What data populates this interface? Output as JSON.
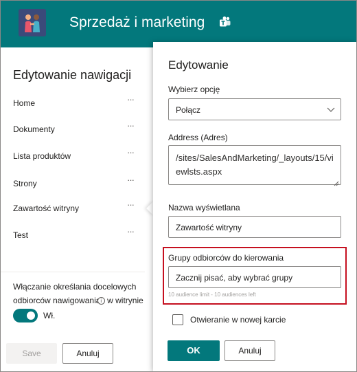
{
  "header": {
    "site_title": "Sprzedaż i marketing",
    "logo_icon": "site-logo-people-icon",
    "teams_icon": "teams-icon",
    "brand_color": "#03787c"
  },
  "nav": {
    "title": "Edytowanie nawigacji",
    "items": [
      {
        "label": "Home",
        "more": "···"
      },
      {
        "label": "Dokumenty",
        "more": "···"
      },
      {
        "label": "Lista produktów",
        "more": "···"
      },
      {
        "label": "Strony",
        "more": "···"
      },
      {
        "label": "Zawartość witryny",
        "more": "···"
      },
      {
        "label": "Test",
        "more": "···"
      }
    ],
    "audience_text_1": "Włączanie określania docelowych odbiorców nawigowania",
    "audience_text_2": "w witrynie",
    "info_icon": "i",
    "toggle_label": "Wł.",
    "toggle_on": true,
    "save_label": "Save",
    "cancel_label": "Anuluj"
  },
  "edit": {
    "title": "Edytowanie",
    "option_label": "Wybierz opcję",
    "option_value": "Połącz",
    "address_label": "Address (Adres)",
    "address_value": "/sites/SalesAndMarketing/_layouts/15/viewlsts.aspx",
    "display_name_label": "Nazwa wyświetlana",
    "display_name_value": "Zawartość witryny",
    "audience_label": "Grupy odbiorców do kierowania",
    "audience_placeholder": "Zacznij pisać, aby wybrać grupy",
    "audience_hint": "10 audience limit - 10 audiences left",
    "new_tab_label": "Otwieranie w nowej karcie",
    "new_tab_checked": false,
    "ok_label": "OK",
    "cancel_label": "Anuluj",
    "highlight_color": "#c50f1f"
  }
}
